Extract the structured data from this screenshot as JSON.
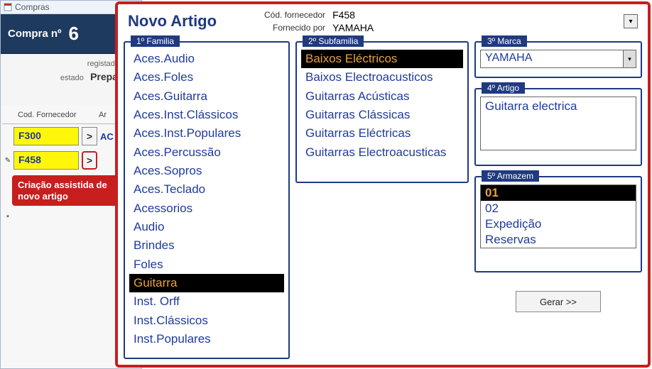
{
  "bg": {
    "tab_title": "Compras",
    "header_label": "Compra nº",
    "header_value": "6",
    "registado_label": "registado por",
    "estado_label": "estado",
    "estado_value": "Preparaç",
    "col_cod": "Cod. Fornecedor",
    "col_art": "Ar",
    "rows": [
      {
        "cod": "F300",
        "art": "AC"
      },
      {
        "cod": "F458",
        "art": ""
      }
    ],
    "callout": "Criação assistida de novo artigo"
  },
  "wizard": {
    "title": "Novo Artigo",
    "meta_cod_label": "Cód. fornecedor",
    "meta_cod_value": "F458",
    "meta_forn_label": "Fornecido por",
    "meta_forn_value": "YAMAHA",
    "familia_legend": "1º Familia",
    "familia": [
      "Aces.Audio",
      "Aces.Foles",
      "Aces.Guitarra",
      "Aces.Inst.Clássicos",
      "Aces.Inst.Populares",
      "Aces.Percussão",
      "Aces.Sopros",
      "Aces.Teclado",
      "Acessorios",
      "Audio",
      "Brindes",
      "Foles",
      "Guitarra",
      "Inst. Orff",
      "Inst.Clássicos",
      "Inst.Populares"
    ],
    "familia_sel": 12,
    "subfam_legend": "2º Subfamilia",
    "subfam": [
      "Baixos Eléctricos",
      "Baixos Electroacusticos",
      "Guitarras Acústicas",
      "Guitarras Clássicas",
      "Guitarras Eléctricas",
      "Guitarras Electroacusticas"
    ],
    "subfam_sel": 0,
    "marca_legend": "3º Marca",
    "marca_value": "YAMAHA",
    "artigo_legend": "4º Artigo",
    "artigo_value": "Guitarra electrica",
    "armazem_legend": "5º Armazem",
    "armazem": [
      "01",
      "02",
      "Expedição",
      "Reservas"
    ],
    "armazem_sel": 0,
    "gerar_label": "Gerar >>"
  }
}
